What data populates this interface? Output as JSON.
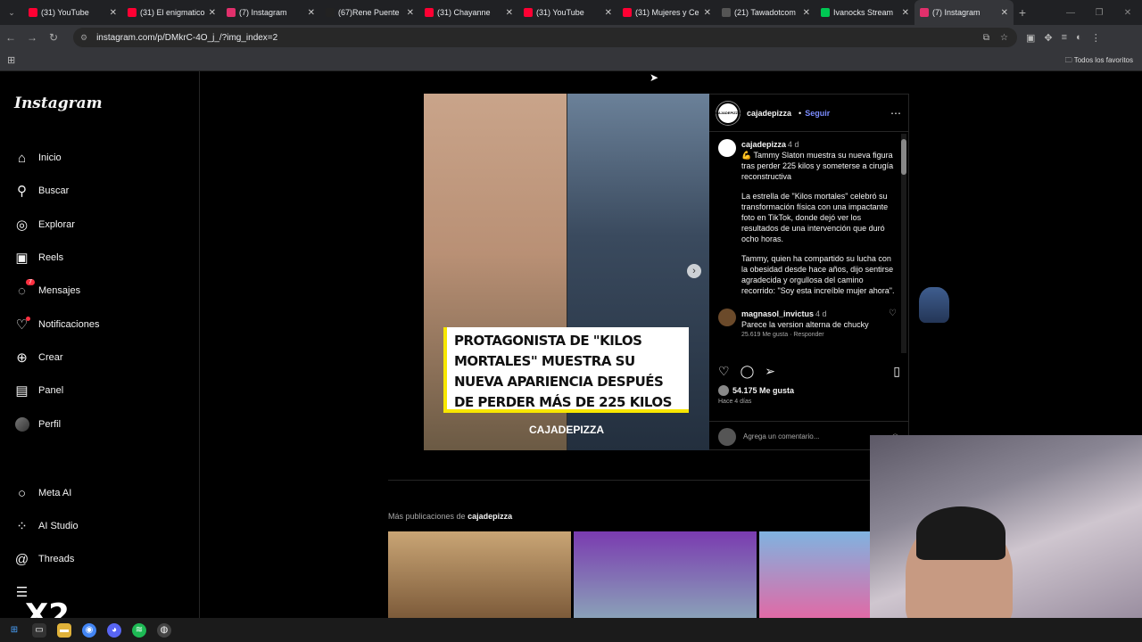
{
  "browser": {
    "tabs": [
      {
        "title": "(31) YouTube",
        "color": "#ff0033"
      },
      {
        "title": "(31) El enigmatico",
        "color": "#ff0033"
      },
      {
        "title": "(7) Instagram",
        "color": "#e1306c"
      },
      {
        "title": "(67)Rene Puente",
        "color": "#222222"
      },
      {
        "title": "(31) Chayanne",
        "color": "#ff0033"
      },
      {
        "title": "(31) YouTube",
        "color": "#ff0033"
      },
      {
        "title": "(31) Mujeres y Ce",
        "color": "#ff0033"
      },
      {
        "title": "(21) Tawadotcom",
        "color": "#555555"
      },
      {
        "title": "Ivanocks Stream",
        "color": "#00c853"
      },
      {
        "title": "(7) Instagram",
        "color": "#e1306c"
      }
    ],
    "url": "instagram.com/p/DMkrC-4O_j_/?img_index=2",
    "bookmarks_label": "Todos los favoritos"
  },
  "sidebar": {
    "logo": "Instagram",
    "items": [
      {
        "label": "Inicio",
        "icon": "home-icon",
        "glyph": "⌂"
      },
      {
        "label": "Buscar",
        "icon": "search-icon",
        "glyph": "⚲"
      },
      {
        "label": "Explorar",
        "icon": "compass-icon",
        "glyph": "◎"
      },
      {
        "label": "Reels",
        "icon": "reels-icon",
        "glyph": "▣"
      },
      {
        "label": "Mensajes",
        "icon": "messenger-icon",
        "glyph": "◌",
        "badge": "7"
      },
      {
        "label": "Notificaciones",
        "icon": "heart-icon",
        "glyph": "♡"
      },
      {
        "label": "Crear",
        "icon": "plus-icon",
        "glyph": "⊕"
      },
      {
        "label": "Panel",
        "icon": "dashboard-icon",
        "glyph": "▤"
      },
      {
        "label": "Perfil",
        "icon": "avatar-icon",
        "glyph": ""
      }
    ],
    "bottom_items": [
      {
        "label": "Meta AI",
        "icon": "meta-ai-icon",
        "glyph": "○"
      },
      {
        "label": "AI Studio",
        "icon": "ai-studio-icon",
        "glyph": "⁘"
      },
      {
        "label": "Threads",
        "icon": "threads-icon",
        "glyph": "@"
      },
      {
        "label": "",
        "icon": "menu-icon",
        "glyph": "☰"
      }
    ],
    "overlay_text": "X2"
  },
  "post": {
    "image_headline": "PROTAGONISTA DE \"KILOS MORTALES\" MUESTRA SU NUEVA APARIENCIA DESPUÉS DE PERDER MÁS DE 225 KILOS",
    "image_brand": "CAJADEPIZZA",
    "author": "cajadepizza",
    "follow_label": "Seguir",
    "separator": "•",
    "caption_time": "4 d",
    "caption_p1": "💪 Tammy Slaton muestra su nueva figura tras perder 225 kilos y someterse a cirugía reconstructiva",
    "caption_p2": "La estrella de \"Kilos mortales\" celebró su transformación física con una impactante foto en TikTok, donde dejó ver los resultados de una intervención que duró ocho horas.",
    "caption_p3": "Tammy, quien ha compartido su lucha con la obesidad desde hace años, dijo sentirse agradecida y orgullosa del camino recorrido: \"Soy esta increíble mujer ahora\".",
    "comment": {
      "user": "magnasol_invictus",
      "time": "4 d",
      "text": "Parece la version alterna de chucky",
      "meta": "25.619 Me gusta · Responder"
    },
    "likes": "54.175 Me gusta",
    "ago": "Hace 4 días",
    "add_comment_placeholder": "Agrega un comentario..."
  },
  "more": {
    "prefix": "Más publicaciones de",
    "user": "cajadepizza"
  }
}
